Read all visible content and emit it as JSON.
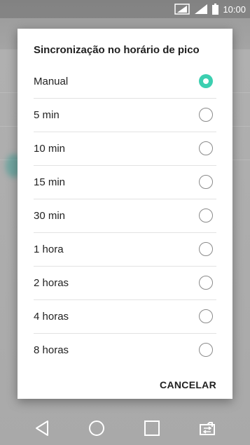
{
  "status": {
    "time": "10:00"
  },
  "dialog": {
    "title": "Sincronização no horário de pico",
    "options": [
      {
        "label": "Manual",
        "selected": true
      },
      {
        "label": "5 min",
        "selected": false
      },
      {
        "label": "10 min",
        "selected": false
      },
      {
        "label": "15 min",
        "selected": false
      },
      {
        "label": "30 min",
        "selected": false
      },
      {
        "label": "1 hora",
        "selected": false
      },
      {
        "label": "2 horas",
        "selected": false
      },
      {
        "label": "4 horas",
        "selected": false
      },
      {
        "label": "8 horas",
        "selected": false
      }
    ],
    "cancel_label": "CANCELAR"
  },
  "icons": {
    "status": [
      "sim-icon",
      "signal-icon",
      "battery-icon"
    ],
    "nav": [
      "back-icon",
      "home-icon",
      "recents-icon",
      "switch-sim-icon"
    ]
  },
  "colors": {
    "accent": "#3ccfb0"
  }
}
